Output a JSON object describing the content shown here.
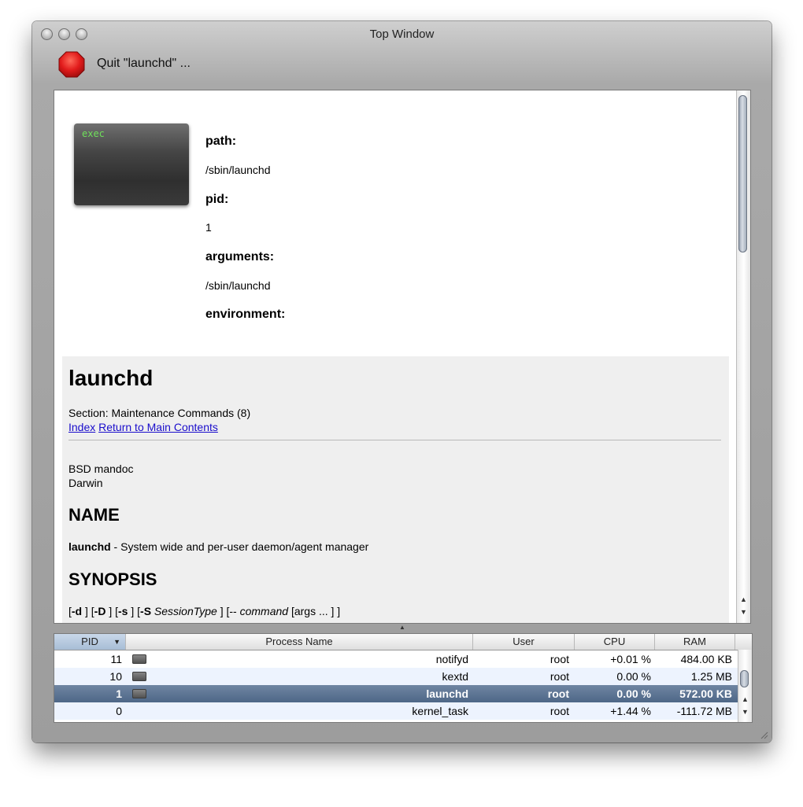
{
  "window": {
    "title": "Top Window",
    "colors": {
      "stop_red": "#e11b1b",
      "selection": "#566e8e",
      "link": "#1a0dcc",
      "exec_green": "#6fe05a"
    }
  },
  "toolbar": {
    "quit_label": "Quit \"launchd\" ..."
  },
  "process_info": {
    "icon_text": "exec",
    "path_label": "path:",
    "path_value": "/sbin/launchd",
    "pid_label": "pid:",
    "pid_value": "1",
    "arguments_label": "arguments:",
    "arguments_value": "/sbin/launchd",
    "environment_label": "environment:"
  },
  "manpage": {
    "title": "launchd",
    "section": "Section: Maintenance Commands (8)",
    "link_index": "Index",
    "link_return": "Return to Main Contents",
    "line1": "BSD mandoc",
    "line2": "Darwin",
    "name_heading": "NAME",
    "name_cmd": "launchd",
    "name_desc": " - System wide and per-user daemon/agent manager",
    "synopsis_heading": "SYNOPSIS",
    "synopsis": {
      "p1": "[",
      "d": "-d",
      "p2": " ] [",
      "D": "-D",
      "p3": " ] [",
      "s": "-s",
      "p4": " ] [",
      "S": "-S",
      "sesstype": " SessionType",
      "p5": " ] [-- ",
      "command": "command",
      "args": " [args ... ] ]"
    }
  },
  "table": {
    "columns": [
      "PID",
      "Process Name",
      "User",
      "CPU",
      "RAM"
    ],
    "sort_indicator": "▼",
    "rows": [
      {
        "pid": "11",
        "name": "notifyd",
        "user": "root",
        "cpu": "+0.01 %",
        "ram": "484.00 KB"
      },
      {
        "pid": "10",
        "name": "kextd",
        "user": "root",
        "cpu": "0.00 %",
        "ram": "1.25 MB"
      },
      {
        "pid": "1",
        "name": "launchd",
        "user": "root",
        "cpu": "0.00 %",
        "ram": "572.00 KB"
      },
      {
        "pid": "0",
        "name": "kernel_task",
        "user": "root",
        "cpu": "+1.44 %",
        "ram": "-111.72 MB"
      }
    ]
  }
}
